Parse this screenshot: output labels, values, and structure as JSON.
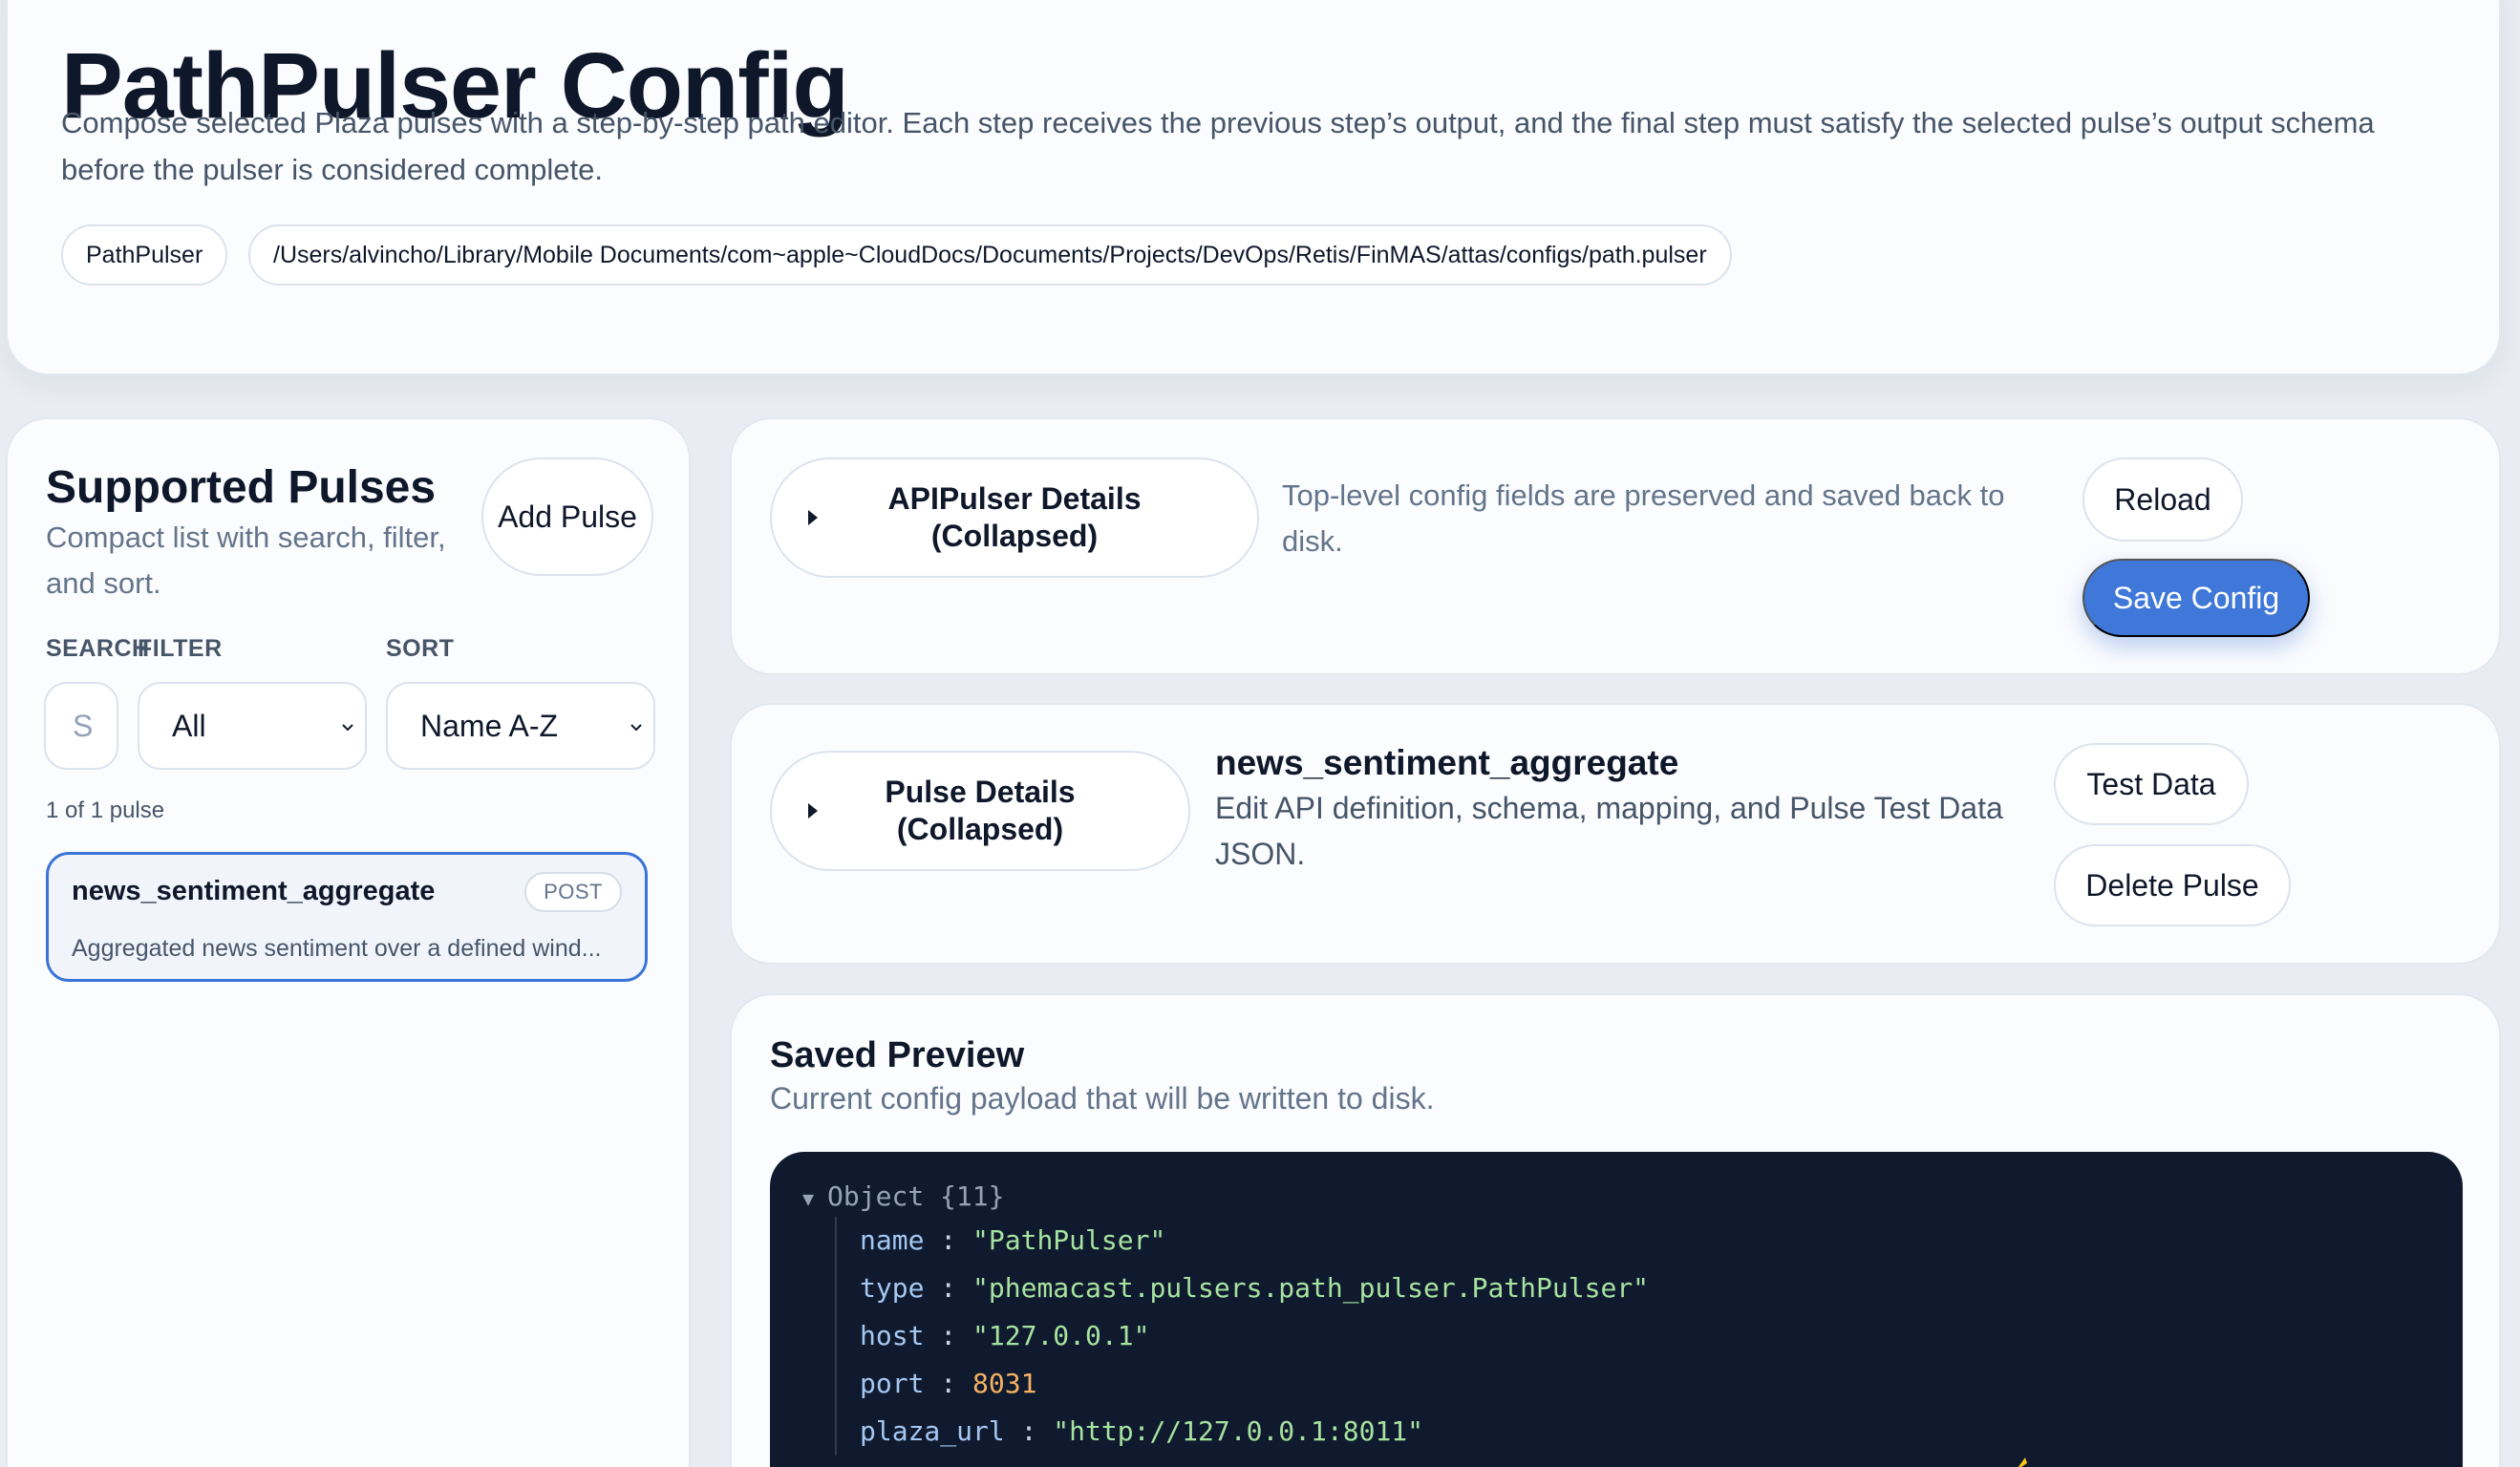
{
  "header": {
    "title": "PathPulser Config",
    "description": "Compose selected Plaza pulses with a step-by-step path editor. Each step receives the previous step’s output, and the final step must satisfy the selected pulse’s output schema before the pulser is considered complete.",
    "pulser_name": "PathPulser",
    "config_path": "/Users/alvincho/Library/Mobile Documents/com~apple~CloudDocs/Documents/Projects/DevOps/Retis/FinMAS/attas/configs/path.pulser"
  },
  "sidebar": {
    "title": "Supported Pulses",
    "description": "Compact list with search, filter, and sort.",
    "add_button": "Add Pulse",
    "search_label": "SEARCH",
    "search_placeholder": "S",
    "filter_label": "FILTER",
    "filter_value": "All",
    "sort_label": "SORT",
    "sort_value": "Name A-Z",
    "count_text": "1 of 1 pulse",
    "items": [
      {
        "name": "news_sentiment_aggregate",
        "method": "POST",
        "description": "Aggregated news sentiment over a defined wind..."
      }
    ]
  },
  "api_section": {
    "toggle_label": "APIPulser Details (Collapsed)",
    "note": "Top-level config fields are preserved and saved back to disk.",
    "reload_button": "Reload",
    "save_button": "Save Config"
  },
  "pulse_section": {
    "toggle_label": "Pulse Details (Collapsed)",
    "title": "news_sentiment_aggregate",
    "note": "Edit API definition, schema, mapping, and Pulse Test Data JSON.",
    "test_button": "Test Data",
    "delete_button": "Delete Pulse"
  },
  "preview": {
    "title": "Saved Preview",
    "description": "Current config payload that will be written to disk.",
    "object_label": "Object {11}",
    "lines": [
      {
        "key": "name",
        "value": "\"PathPulser\"",
        "kind": "string"
      },
      {
        "key": "type",
        "value": "\"phemacast.pulsers.path_pulser.PathPulser\"",
        "kind": "string"
      },
      {
        "key": "host",
        "value": "\"127.0.0.1\"",
        "kind": "string"
      },
      {
        "key": "port",
        "value": "8031",
        "kind": "number"
      },
      {
        "key": "plaza_url",
        "value": "\"http://127.0.0.1:8011\"",
        "kind": "string"
      }
    ]
  },
  "colors": {
    "accent": "#3f78d8",
    "code_background": "#101a2e",
    "code_key": "#a5c8f2",
    "code_string": "#a7e3a0",
    "code_number": "#f5b262"
  }
}
